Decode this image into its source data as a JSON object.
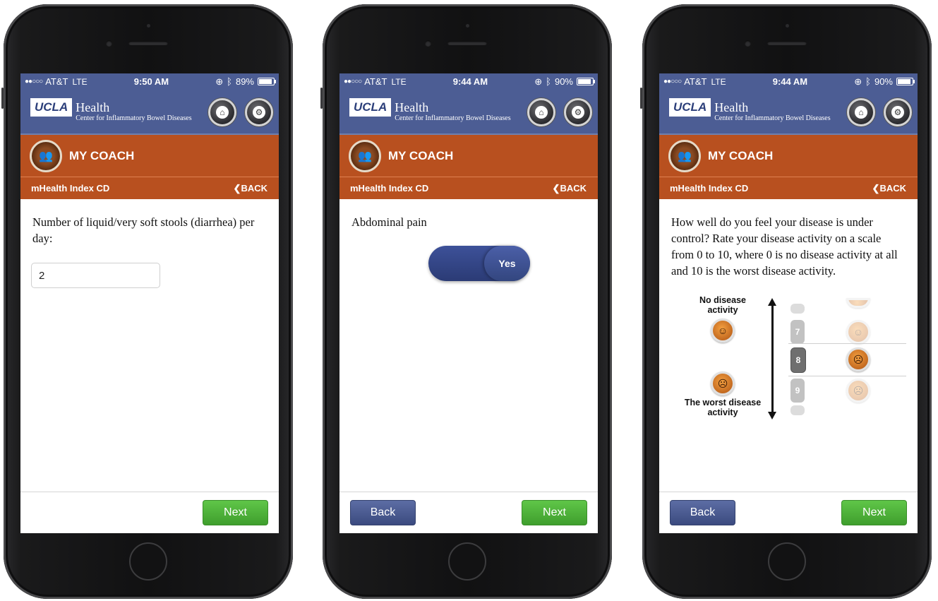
{
  "phones": [
    {
      "status": {
        "carrier": "AT&T",
        "network": "LTE",
        "time": "9:50 AM",
        "battery": "89%",
        "battery_level": 0.89
      },
      "header": {
        "logo": "UCLA",
        "brand": "Health",
        "subtitle": "Center for Inflammatory Bowel Diseases"
      },
      "coach_title": "MY COACH",
      "subbar": {
        "title": "mHealth Index CD",
        "back": "BACK"
      },
      "question": "Number of liquid/very soft stools (diarrhea) per day:",
      "input_value": "2",
      "next_label": "Next"
    },
    {
      "status": {
        "carrier": "AT&T",
        "network": "LTE",
        "time": "9:44 AM",
        "battery": "90%",
        "battery_level": 0.9
      },
      "header": {
        "logo": "UCLA",
        "brand": "Health",
        "subtitle": "Center for Inflammatory Bowel Diseases"
      },
      "coach_title": "MY COACH",
      "subbar": {
        "title": "mHealth Index CD",
        "back": "BACK"
      },
      "question": "Abdominal pain",
      "toggle_label": "Yes",
      "back_label": "Back",
      "next_label": "Next"
    },
    {
      "status": {
        "carrier": "AT&T",
        "network": "LTE",
        "time": "9:44 AM",
        "battery": "90%",
        "battery_level": 0.9
      },
      "header": {
        "logo": "UCLA",
        "brand": "Health",
        "subtitle": "Center for Inflammatory Bowel Diseases"
      },
      "coach_title": "MY COACH",
      "subbar": {
        "title": "mHealth Index CD",
        "back": "BACK"
      },
      "question": "How well do you feel your disease is under control? Rate your disease activity on a scale from 0 to 10, where 0 is no disease activity at all and 10 is the worst disease activity.",
      "scale_top": "No disease activity",
      "scale_bottom": "The worst disease activity",
      "picker": {
        "above": "7",
        "selected": "8",
        "below": "9"
      },
      "back_label": "Back",
      "next_label": "Next"
    }
  ],
  "icons": {
    "home": "home-icon",
    "settings": "gear-icon",
    "coach": "people-icon",
    "back_chevron": "chevron-left-icon",
    "bluetooth": "bluetooth-icon",
    "rotation_lock": "rotation-lock-icon"
  },
  "colors": {
    "header_blue": "#4c5d94",
    "coach_orange": "#b8501f",
    "next_green": "#4fb33a",
    "back_blue": "#4a5b92"
  }
}
